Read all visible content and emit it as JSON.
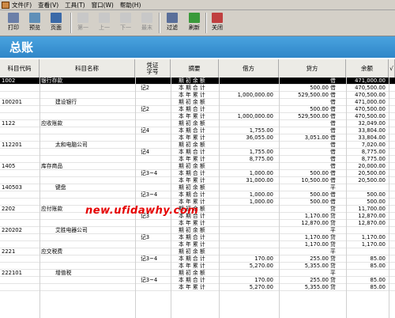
{
  "menu": [
    "文件(F)",
    "查看(V)",
    "工具(T)",
    "窗口(W)",
    "帮助(H)"
  ],
  "toolbar": [
    {
      "label": "打印",
      "icon": "printer-icon",
      "enabled": true
    },
    {
      "label": "预览",
      "icon": "preview-icon",
      "enabled": true
    },
    {
      "label": "页面",
      "icon": "page-setup-icon",
      "enabled": true
    },
    {
      "label": "第一",
      "icon": "first-icon",
      "enabled": false
    },
    {
      "label": "上一",
      "icon": "prev-icon",
      "enabled": false
    },
    {
      "label": "下一",
      "icon": "next-icon",
      "enabled": false
    },
    {
      "label": "最末",
      "icon": "last-icon",
      "enabled": false
    },
    {
      "label": "过滤",
      "icon": "filter-icon",
      "enabled": true
    },
    {
      "label": "刷新",
      "icon": "refresh-icon",
      "enabled": true
    },
    {
      "label": "关闭",
      "icon": "close-icon",
      "enabled": true
    }
  ],
  "title": "总账",
  "headers": [
    "科目代码",
    "科目名称",
    "凭证字号",
    "摘要",
    "借方",
    "贷方",
    "余额",
    "√"
  ],
  "watermark": "new.ufidawhy.com",
  "rows": [
    {
      "code": "1002",
      "name": "银行存款",
      "voucher": "",
      "summary": "期 初 余 额",
      "debit": "",
      "credit": "",
      "dir": "借",
      "balance": "471,000.00",
      "selected": true
    },
    {
      "code": "",
      "name": "",
      "voucher": "记2",
      "summary": "本 期 合 计",
      "debit": "",
      "credit": "500.00",
      "dir": "借",
      "balance": "470,500.00"
    },
    {
      "code": "",
      "name": "",
      "voucher": "",
      "summary": "本 年 累 计",
      "debit": "1,000,000.00",
      "credit": "529,500.00",
      "dir": "借",
      "balance": "470,500.00"
    },
    {
      "code": "100201",
      "name": "建设银行",
      "voucher": "",
      "summary": "期 初 余 额",
      "debit": "",
      "credit": "",
      "dir": "借",
      "balance": "471,000.00"
    },
    {
      "code": "",
      "name": "",
      "voucher": "记2",
      "summary": "本 期 合 计",
      "debit": "",
      "credit": "500.00",
      "dir": "借",
      "balance": "470,500.00"
    },
    {
      "code": "",
      "name": "",
      "voucher": "",
      "summary": "本 年 累 计",
      "debit": "1,000,000.00",
      "credit": "529,500.00",
      "dir": "借",
      "balance": "470,500.00"
    },
    {
      "code": "1122",
      "name": "应收账款",
      "voucher": "",
      "summary": "期 初 余 额",
      "debit": "",
      "credit": "",
      "dir": "借",
      "balance": "32,049.00"
    },
    {
      "code": "",
      "name": "",
      "voucher": "记4",
      "summary": "本 期 合 计",
      "debit": "1,755.00",
      "credit": "",
      "dir": "借",
      "balance": "33,804.00"
    },
    {
      "code": "",
      "name": "",
      "voucher": "",
      "summary": "本 年 累 计",
      "debit": "36,055.00",
      "credit": "3,051.00",
      "dir": "借",
      "balance": "33,804.00"
    },
    {
      "code": "112201",
      "name": "太和电脑公司",
      "voucher": "",
      "summary": "期 初 余 额",
      "debit": "",
      "credit": "",
      "dir": "借",
      "balance": "7,020.00"
    },
    {
      "code": "",
      "name": "",
      "voucher": "记4",
      "summary": "本 期 合 计",
      "debit": "1,755.00",
      "credit": "",
      "dir": "借",
      "balance": "8,775.00"
    },
    {
      "code": "",
      "name": "",
      "voucher": "",
      "summary": "本 年 累 计",
      "debit": "8,775.00",
      "credit": "",
      "dir": "借",
      "balance": "8,775.00"
    },
    {
      "code": "1405",
      "name": "库存商品",
      "voucher": "",
      "summary": "期 初 余 额",
      "debit": "",
      "credit": "",
      "dir": "借",
      "balance": "20,000.00"
    },
    {
      "code": "",
      "name": "",
      "voucher": "记3~4",
      "summary": "本 期 合 计",
      "debit": "1,000.00",
      "credit": "500.00",
      "dir": "借",
      "balance": "20,500.00"
    },
    {
      "code": "",
      "name": "",
      "voucher": "",
      "summary": "本 年 累 计",
      "debit": "31,000.00",
      "credit": "10,500.00",
      "dir": "借",
      "balance": "20,500.00"
    },
    {
      "code": "140503",
      "name": "键盘",
      "voucher": "",
      "summary": "期 初 余 额",
      "debit": "",
      "credit": "",
      "dir": "平",
      "balance": ""
    },
    {
      "code": "",
      "name": "",
      "voucher": "记3~4",
      "summary": "本 期 合 计",
      "debit": "1,000.00",
      "credit": "500.00",
      "dir": "借",
      "balance": "500.00"
    },
    {
      "code": "",
      "name": "",
      "voucher": "",
      "summary": "本 年 累 计",
      "debit": "1,000.00",
      "credit": "500.00",
      "dir": "借",
      "balance": "500.00"
    },
    {
      "code": "2202",
      "name": "应付账款",
      "voucher": "",
      "summary": "期 初 余 额",
      "debit": "",
      "credit": "",
      "dir": "贷",
      "balance": "11,700.00"
    },
    {
      "code": "",
      "name": "",
      "voucher": "记3",
      "summary": "本 期 合 计",
      "debit": "",
      "credit": "1,170.00",
      "dir": "贷",
      "balance": "12,870.00"
    },
    {
      "code": "",
      "name": "",
      "voucher": "",
      "summary": "本 年 累 计",
      "debit": "",
      "credit": "12,870.00",
      "dir": "贷",
      "balance": "12,870.00"
    },
    {
      "code": "220202",
      "name": "艾胜电器公司",
      "voucher": "",
      "summary": "期 初 余 额",
      "debit": "",
      "credit": "",
      "dir": "平",
      "balance": ""
    },
    {
      "code": "",
      "name": "",
      "voucher": "记3",
      "summary": "本 期 合 计",
      "debit": "",
      "credit": "1,170.00",
      "dir": "贷",
      "balance": "1,170.00"
    },
    {
      "code": "",
      "name": "",
      "voucher": "",
      "summary": "本 年 累 计",
      "debit": "",
      "credit": "1,170.00",
      "dir": "贷",
      "balance": "1,170.00"
    },
    {
      "code": "2221",
      "name": "应交税费",
      "voucher": "",
      "summary": "期 初 余 额",
      "debit": "",
      "credit": "",
      "dir": "平",
      "balance": ""
    },
    {
      "code": "",
      "name": "",
      "voucher": "记3~4",
      "summary": "本 期 合 计",
      "debit": "170.00",
      "credit": "255.00",
      "dir": "贷",
      "balance": "85.00"
    },
    {
      "code": "",
      "name": "",
      "voucher": "",
      "summary": "本 年 累 计",
      "debit": "5,270.00",
      "credit": "5,355.00",
      "dir": "贷",
      "balance": "85.00"
    },
    {
      "code": "222101",
      "name": "增值税",
      "voucher": "",
      "summary": "期 初 余 额",
      "debit": "",
      "credit": "",
      "dir": "平",
      "balance": ""
    },
    {
      "code": "",
      "name": "",
      "voucher": "记3~4",
      "summary": "本 期 合 计",
      "debit": "170.00",
      "credit": "255.00",
      "dir": "贷",
      "balance": "85.00"
    },
    {
      "code": "",
      "name": "",
      "voucher": "",
      "summary": "本 年 累 计",
      "debit": "5,270.00",
      "credit": "5,355.00",
      "dir": "贷",
      "balance": "85.00"
    }
  ]
}
